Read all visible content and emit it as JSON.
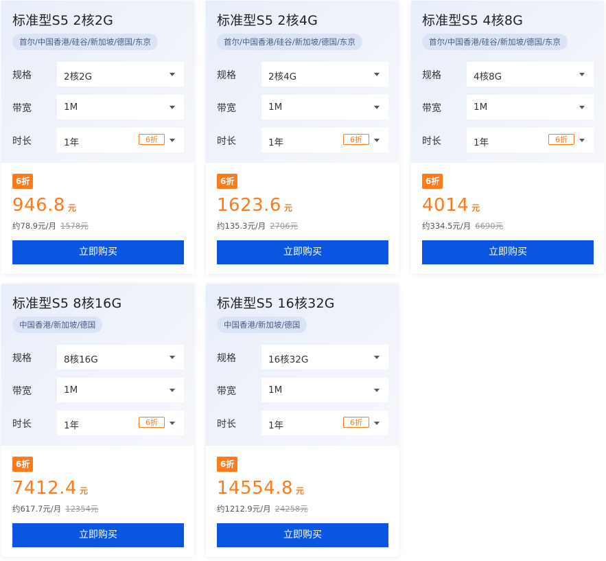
{
  "labels": {
    "spec": "规格",
    "bandwidth": "带宽",
    "duration": "时长",
    "currency_unit": "元",
    "monthly_suffix": "元/月",
    "monthly_prefix": "约",
    "buy_button": "立即购买"
  },
  "products": [
    {
      "title": "标准型S5 2核2G",
      "regions": "首尔/中国香港/硅谷/新加坡/德国/东京",
      "spec": "2核2G",
      "bandwidth": "1M",
      "duration": "1年",
      "duration_discount": "6折",
      "discount_badge": "6折",
      "price": "946.8",
      "monthly": "约78.9元/月",
      "original_price": "1578元"
    },
    {
      "title": "标准型S5 2核4G",
      "regions": "首尔/中国香港/硅谷/新加坡/德国/东京",
      "spec": "2核4G",
      "bandwidth": "1M",
      "duration": "1年",
      "duration_discount": "6折",
      "discount_badge": "6折",
      "price": "1623.6",
      "monthly": "约135.3元/月",
      "original_price": "2706元"
    },
    {
      "title": "标准型S5 4核8G",
      "regions": "首尔/中国香港/硅谷/新加坡/德国/东京",
      "spec": "4核8G",
      "bandwidth": "1M",
      "duration": "1年",
      "duration_discount": "6折",
      "discount_badge": "6折",
      "price": "4014",
      "monthly": "约334.5元/月",
      "original_price": "6690元"
    },
    {
      "title": "标准型S5 8核16G",
      "regions": "中国香港/新加坡/德国",
      "spec": "8核16G",
      "bandwidth": "1M",
      "duration": "1年",
      "duration_discount": "6折",
      "discount_badge": "6折",
      "price": "7412.4",
      "monthly": "约617.7元/月",
      "original_price": "12354元"
    },
    {
      "title": "标准型S5 16核32G",
      "regions": "中国香港/新加坡/德国",
      "spec": "16核32G",
      "bandwidth": "1M",
      "duration": "1年",
      "duration_discount": "6折",
      "discount_badge": "6折",
      "price": "14554.8",
      "monthly": "约1212.9元/月",
      "original_price": "24258元"
    }
  ],
  "colors": {
    "accent_orange": "#ff7a1a",
    "button_blue": "#0b56e0",
    "region_tag_bg": "#dbe4f7"
  },
  "icons": {
    "dropdown": "chevron-down-icon"
  }
}
